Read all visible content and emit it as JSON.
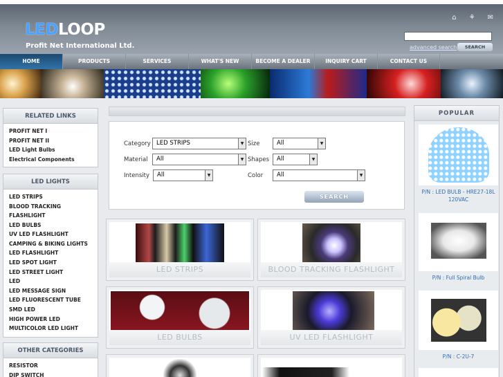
{
  "header": {
    "logo_led": "LED",
    "logo_loop": "LOOP",
    "tagline": "Profit Net International Ltd.",
    "icons": [
      "home-icon",
      "sitemap-icon",
      "mail-icon"
    ],
    "search_placeholder": "",
    "advanced_search": "advanced search",
    "search_button": "SEARCH"
  },
  "nav": {
    "items": [
      {
        "label": "HOME"
      },
      {
        "label": "PRODUCTS"
      },
      {
        "label": "SERVICES"
      },
      {
        "label": "WHAT'S NEW"
      },
      {
        "label": "BECOME A DEALER"
      },
      {
        "label": "INQUIRY CART"
      },
      {
        "label": "CONTACT US"
      }
    ]
  },
  "sidebar": {
    "related_title": "RELATED LINKS",
    "related": [
      "PROFIT NET I",
      "PROFIT NET II",
      "LED Light Bulbs",
      "Electrical Components"
    ],
    "lights_title": "LED LIGHTS",
    "lights": [
      "LED STRIPS",
      "BLOOD TRACKING FLASHLIGHT",
      "LED BULBS",
      "UV LED FLASHLIGHT",
      "CAMPING & BIKING LIGHTS",
      "LED FLASHLIGHT",
      "LED SPOT LIGHT",
      "LED STREET LIGHT",
      "LED",
      "LED MESSAGE SIGN",
      "LED FLUORESCENT TUBE",
      "SMD LED",
      "HIGH POWER LED",
      "MULTICOLOR LED LIGHT"
    ],
    "other_title": "OTHER CATEGORIES",
    "other": [
      "RESISTOR",
      "DIP SWITCH"
    ]
  },
  "filters": {
    "category_label": "Category",
    "category_value": "LED STRIPS",
    "size_label": "Size",
    "size_value": "All",
    "material_label": "Material",
    "material_value": "All",
    "shapes_label": "Shapes",
    "shapes_value": "All",
    "intensity_label": "Intensity",
    "intensity_value": "All",
    "color_label": "Color",
    "color_value": "All",
    "search_button": "SEARCH"
  },
  "products": [
    {
      "title": "LED STRIPS"
    },
    {
      "title": "BLOOD TRACKING FLASHLIGHT"
    },
    {
      "title": "LED BULBS"
    },
    {
      "title": "UV LED FLASHLIGHT"
    }
  ],
  "popular": {
    "title": "POPULAR",
    "items": [
      {
        "caption": "P/N : LED BULB - HRE27-18L 120VAC"
      },
      {
        "caption": "P/N : Full Spiral Bulb"
      },
      {
        "caption": "P/N : C-2U-7"
      }
    ]
  },
  "colors": {
    "accent": "#2f6db3",
    "nav_active": "#1c4a72"
  }
}
